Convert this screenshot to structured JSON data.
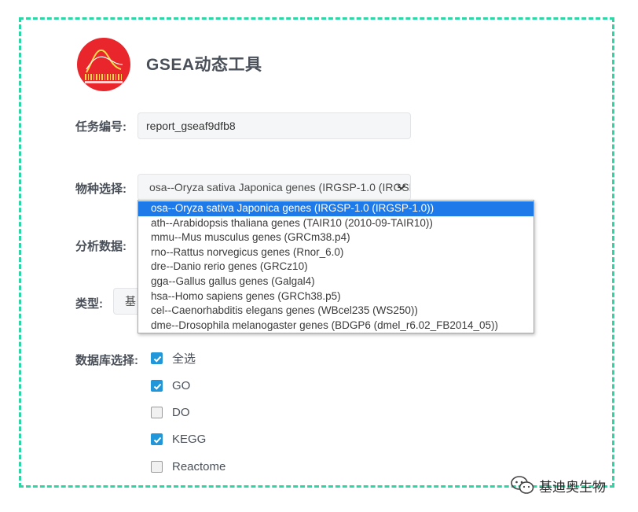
{
  "app": {
    "title": "GSEA动态工具"
  },
  "form": {
    "task_id_label": "任务编号:",
    "task_id_value": "report_gseaf9dfb8",
    "species_label": "物种选择:",
    "species_selected": "osa--Oryza sativa Japonica genes (IRGSP-1.0 (IRGSP-1.0))",
    "analysis_label": "分析数据:",
    "type_label": "类型:",
    "type_value": "基",
    "db_label": "数据库选择:"
  },
  "species_options": [
    "osa--Oryza sativa Japonica genes (IRGSP-1.0 (IRGSP-1.0))",
    "ath--Arabidopsis thaliana genes (TAIR10 (2010-09-TAIR10))",
    "mmu--Mus musculus genes (GRCm38.p4)",
    "rno--Rattus norvegicus genes (Rnor_6.0)",
    "dre--Danio rerio genes (GRCz10)",
    "gga--Gallus gallus genes (Galgal4)",
    "hsa--Homo sapiens genes (GRCh38.p5)",
    "cel--Caenorhabditis elegans genes (WBcel235 (WS250))",
    "dme--Drosophila melanogaster genes (BDGP6 (dmel_r6.02_FB2014_05))"
  ],
  "databases": [
    {
      "label": "全选",
      "checked": true
    },
    {
      "label": "GO",
      "checked": true
    },
    {
      "label": "DO",
      "checked": false
    },
    {
      "label": "KEGG",
      "checked": true
    },
    {
      "label": "Reactome",
      "checked": false
    }
  ],
  "watermark": {
    "text": "基迪奥生物"
  },
  "colors": {
    "frame_border": "#2ed6a6",
    "checkbox_checked": "#2196d9",
    "option_selected": "#1e7ae8",
    "logo_red": "#e8262c"
  },
  "icons": {
    "logo": "gsea-logo",
    "select_arrow": "chevron-down-icon",
    "watermark": "wechat-icon"
  }
}
